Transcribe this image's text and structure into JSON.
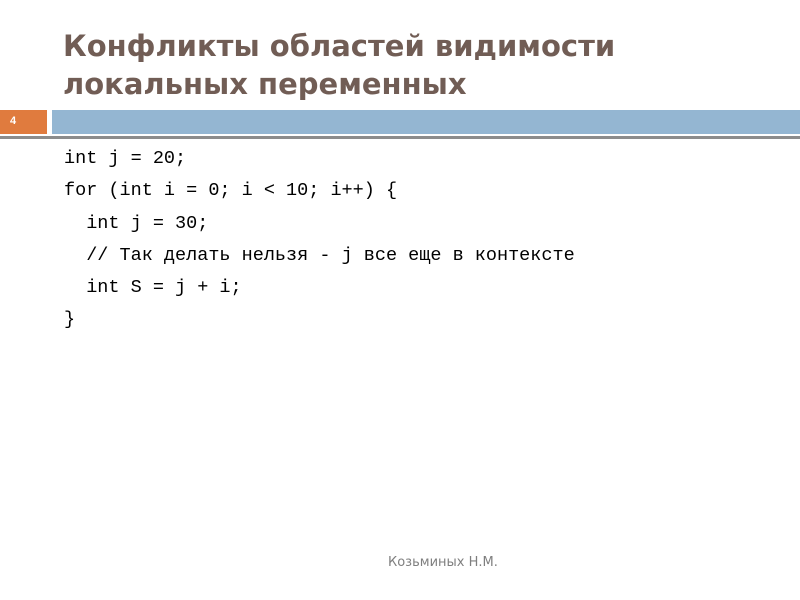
{
  "slide": {
    "title_lines": [
      "Конфликты областей видимости",
      "локальных переменных"
    ],
    "slide_number": "4",
    "colors": {
      "title": "#715d55",
      "number_box": "#e07b3e",
      "header_bar": "#94b6d2",
      "divider": "#8c8c8c"
    },
    "code_lines": [
      "int j = 20;",
      "for (int i = 0; i < 10; i++) {",
      "  int j = 30;",
      "  // Так делать нельзя - j все еще в контексте",
      "  int S = j + i;",
      "}"
    ],
    "footer": "Козьминых Н.М."
  }
}
